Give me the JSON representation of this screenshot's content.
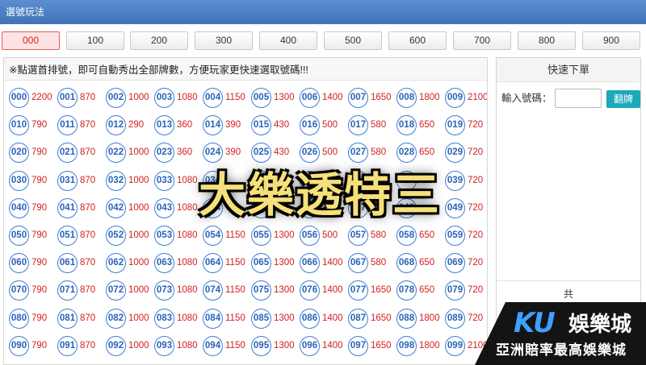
{
  "header": {
    "title": "選號玩法"
  },
  "tabs": [
    {
      "label": "000",
      "active": true
    },
    {
      "label": "100"
    },
    {
      "label": "200"
    },
    {
      "label": "300"
    },
    {
      "label": "400"
    },
    {
      "label": "500"
    },
    {
      "label": "600"
    },
    {
      "label": "700"
    },
    {
      "label": "800"
    },
    {
      "label": "900"
    }
  ],
  "notice": "※點選首排號，即可自動秀出全部牌數，方便玩家更快速選取號碼!!!",
  "numbers": [
    [
      [
        "000",
        "2200"
      ],
      [
        "001",
        "870"
      ],
      [
        "002",
        "1000"
      ],
      [
        "003",
        "1080"
      ],
      [
        "004",
        "1150"
      ],
      [
        "005",
        "1300"
      ],
      [
        "006",
        "1400"
      ],
      [
        "007",
        "1650"
      ],
      [
        "008",
        "1800"
      ],
      [
        "009",
        "2100"
      ]
    ],
    [
      [
        "010",
        "790"
      ],
      [
        "011",
        "870"
      ],
      [
        "012",
        "290"
      ],
      [
        "013",
        "360"
      ],
      [
        "014",
        "390"
      ],
      [
        "015",
        "430"
      ],
      [
        "016",
        "500"
      ],
      [
        "017",
        "580"
      ],
      [
        "018",
        "650"
      ],
      [
        "019",
        "720"
      ]
    ],
    [
      [
        "020",
        "790"
      ],
      [
        "021",
        "870"
      ],
      [
        "022",
        "1000"
      ],
      [
        "023",
        "360"
      ],
      [
        "024",
        "390"
      ],
      [
        "025",
        "430"
      ],
      [
        "026",
        "500"
      ],
      [
        "027",
        "580"
      ],
      [
        "028",
        "650"
      ],
      [
        "029",
        "720"
      ]
    ],
    [
      [
        "030",
        "790"
      ],
      [
        "031",
        "870"
      ],
      [
        "032",
        "1000"
      ],
      [
        "033",
        "1080"
      ],
      [
        "034",
        ""
      ],
      [
        "035",
        ""
      ],
      [
        "036",
        ""
      ],
      [
        "037",
        ""
      ],
      [
        "038",
        ""
      ],
      [
        "039",
        "720"
      ]
    ],
    [
      [
        "040",
        "790"
      ],
      [
        "041",
        "870"
      ],
      [
        "042",
        "1000"
      ],
      [
        "043",
        "1080"
      ],
      [
        "044",
        ""
      ],
      [
        "045",
        ""
      ],
      [
        "046",
        ""
      ],
      [
        "047",
        ""
      ],
      [
        "048",
        ""
      ],
      [
        "049",
        "720"
      ]
    ],
    [
      [
        "050",
        "790"
      ],
      [
        "051",
        "870"
      ],
      [
        "052",
        "1000"
      ],
      [
        "053",
        "1080"
      ],
      [
        "054",
        "1150"
      ],
      [
        "055",
        "1300"
      ],
      [
        "056",
        "500"
      ],
      [
        "057",
        "580"
      ],
      [
        "058",
        "650"
      ],
      [
        "059",
        "720"
      ]
    ],
    [
      [
        "060",
        "790"
      ],
      [
        "061",
        "870"
      ],
      [
        "062",
        "1000"
      ],
      [
        "063",
        "1080"
      ],
      [
        "064",
        "1150"
      ],
      [
        "065",
        "1300"
      ],
      [
        "066",
        "1400"
      ],
      [
        "067",
        "580"
      ],
      [
        "068",
        "650"
      ],
      [
        "069",
        "720"
      ]
    ],
    [
      [
        "070",
        "790"
      ],
      [
        "071",
        "870"
      ],
      [
        "072",
        "1000"
      ],
      [
        "073",
        "1080"
      ],
      [
        "074",
        "1150"
      ],
      [
        "075",
        "1300"
      ],
      [
        "076",
        "1400"
      ],
      [
        "077",
        "1650"
      ],
      [
        "078",
        "650"
      ],
      [
        "079",
        "720"
      ]
    ],
    [
      [
        "080",
        "790"
      ],
      [
        "081",
        "870"
      ],
      [
        "082",
        "1000"
      ],
      [
        "083",
        "1080"
      ],
      [
        "084",
        "1150"
      ],
      [
        "085",
        "1300"
      ],
      [
        "086",
        "1400"
      ],
      [
        "087",
        "1650"
      ],
      [
        "088",
        "1800"
      ],
      [
        "089",
        "720"
      ]
    ],
    [
      [
        "090",
        "790"
      ],
      [
        "091",
        "870"
      ],
      [
        "092",
        "1000"
      ],
      [
        "093",
        "1080"
      ],
      [
        "094",
        "1150"
      ],
      [
        "095",
        "1300"
      ],
      [
        "096",
        "1400"
      ],
      [
        "097",
        "1650"
      ],
      [
        "098",
        "1800"
      ],
      [
        "099",
        "2100"
      ]
    ]
  ],
  "sidebar": {
    "title": "快速下單",
    "input_label": "輸入號碼：",
    "button_label": "翻牌",
    "total_label": "共"
  },
  "overlay": {
    "title": "大樂透特三"
  },
  "brand": {
    "ku": "KU",
    "name": "娛樂城",
    "slogan": "亞洲賠率最高娛樂城"
  },
  "colors": {
    "header": "#4a80c4",
    "ball": "#3b7dd8",
    "odds": "#d32020",
    "active_tab": "#e06060",
    "button": "#19a9b8",
    "overlay_title": "#f6e07a"
  }
}
